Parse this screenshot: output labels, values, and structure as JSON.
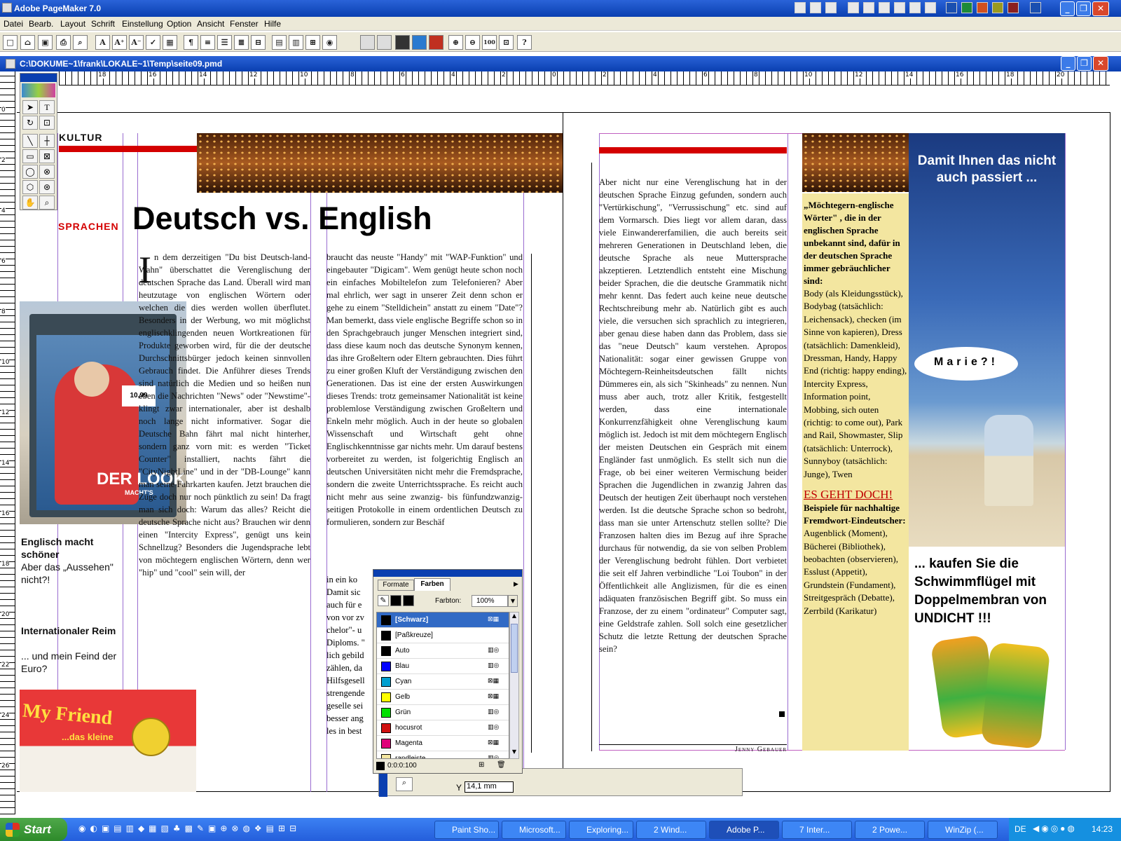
{
  "app": {
    "title": "Adobe PageMaker 7.0"
  },
  "menu": [
    "Datei",
    "Bearb.",
    "Layout",
    "Schrift",
    "Einstellung",
    "Option",
    "Ansicht",
    "Fenster",
    "Hilfe"
  ],
  "toolbar_glyphs": [
    "□",
    "⌂",
    "▣",
    "⎙",
    "⌕",
    "A",
    "A⁺",
    "A⁻",
    "✓",
    "▦",
    "¶",
    "≡",
    "☰",
    "≣",
    "⊟",
    "▤",
    "▥",
    "⊞",
    "◉",
    "⊕",
    "⊖",
    "100",
    "⊡",
    "?"
  ],
  "document": {
    "path": "C:\\DOKUME~1\\frank\\LOKALE~1\\Temp\\seite09.pmd"
  },
  "ruler_top_labels": [
    "18",
    "16",
    "14",
    "12",
    "10",
    "8",
    "6",
    "4",
    "2",
    "0",
    "2",
    "4",
    "6",
    "8",
    "10",
    "12",
    "14",
    "16",
    "18",
    "20"
  ],
  "ruler_left_labels": [
    "0",
    "2",
    "4",
    "6",
    "8",
    "10",
    "12",
    "14",
    "16",
    "18",
    "20",
    "22",
    "24",
    "26"
  ],
  "left_page": {
    "section": "KULTUR",
    "kicker": "SPRACHEN",
    "headline": "Deutsch vs. English",
    "caption1_title": "Englisch macht schöner",
    "caption1_text": "Aber das „Aussehen\" nicht?!",
    "caption2_title": "Internationaler Reim",
    "caption2_text": "... und mein Feind der Euro?",
    "poster_brand": "DER LOOK",
    "poster_sub": "MACHT'S",
    "poster_price": "10,99",
    "sign_text": "My Friend",
    "sign_sub": "...das kleine",
    "dropcap": "I",
    "col1": "n dem derzeitigen \"Du bist Deutsch-land-Wahn\" überschattet die Verenglischung der deutschen Sprache das Land. Überall wird man heutzutage von englischen Wörtern oder welchen die dies werden wollen überflutet. Besonders in der Werbung, wo mit möglichst englischklingenden neuen Wortkreationen für Produkte geworben wird, für die der deutsche Durchschnittsbürger jedoch keinen sinnvollen Gebrauch findet. Die Anführer dieses Trends sind natürlich die Medien und so heißen nun eben die Nachrichten \"News\" oder \"Newstime\"- klingt zwar internationaler, aber ist deshalb noch lange nicht informativer. Sogar die Deutsche Bahn fährt mal nicht hinterher, sondern ganz vorn mit: es werden \"Ticket Counter\" installiert, nachts fährt die \"CityNightLine\" und in der \"DB-Lounge\" kann man seine Fahrkarten kaufen. Jetzt brauchen die Züge doch nur noch pünktlich zu sein! Da fragt man sich doch: Warum das alles? Reicht die deutsche Sprache nicht aus? Brauchen wir denn einen \"Intercity Express\", genügt uns kein Schnellzug? Besonders die Jugendsprache lebt von möchtegern englischen Wörtern, denn wer \"hip\" und \"cool\" sein will, der",
    "col2": "braucht das neuste \"Handy\" mit \"WAP-Funktion\" und eingebauter \"Digicam\". Wem genügt heute schon noch ein einfaches Mobiltelefon zum Telefonieren? Aber mal ehrlich, wer sagt in unserer Zeit denn schon er gehe zu einem \"Stelldichein\" anstatt zu einem \"Date\"? Man bemerkt, dass viele englische Begriffe schon so in den Sprachgebrauch junger Menschen integriert sind, dass diese kaum noch das deutsche Synonym kennen, das ihre Großeltern oder Eltern gebrauchten. Dies führt zu einer großen Kluft der Verständigung zwischen den Generationen. Das ist eine der ersten Auswirkungen dieses Trends: trotz gemeinsamer Nationalität ist keine problemlose Verständigung zwischen Großeltern und Enkeln mehr möglich. Auch in der heute so globalen Wissenschaft und Wirtschaft geht ohne Englischkenntnisse gar nichts mehr. Um darauf bestens vorbereitet zu werden, ist folgerichtig Englisch an deutschen Universitäten nicht mehr die Fremdsprache, sondern die zweite Unterrichtssprache. Es reicht auch nicht mehr aus seine zwanzig- bis fünfundzwanzig-seitigen Protokolle in einem ordentlichen Deutsch zu formulieren, sondern zur Beschäf",
    "col2_tail": [
      "in ein ko",
      "Damit sic",
      "auch für e",
      "von vor zv",
      "chelor\"- u",
      "Diploms. \"",
      "lich gebild",
      "zählen, da",
      "Hilfsgesell",
      "strengende",
      "geselle sei",
      "besser ang",
      "les in best"
    ]
  },
  "right_page": {
    "col1": "Aber nicht nur eine Verenglischung hat in der deutschen Sprache Einzug gefunden, sondern auch \"Vertürkischung\", \"Verrussischung\" etc. sind auf dem Vormarsch. Dies liegt vor allem daran, dass viele Einwandererfamilien, die auch bereits seit mehreren Generationen in Deutschland leben, die deutsche Sprache als neue Muttersprache akzeptieren. Letztendlich entsteht eine Mischung beider Sprachen, die die deutsche Grammatik nicht mehr kennt. Das federt auch keine neue deutsche Rechtschreibung mehr ab. Natürlich gibt es auch viele, die versuchen sich sprachlich zu integrieren, aber genau diese haben dann das Problem, dass sie das \"neue Deutsch\" kaum verstehen. Apropos Nationalität: sogar einer gewissen Gruppe von Möchtegern-Reinheitsdeutschen fällt nichts Dümmeres ein, als sich \"Skinheads\" zu nennen. Nun muss aber auch, trotz aller Kritik, festgestellt werden, dass eine internationale Konkurrenzfähigkeit ohne Verenglischung kaum möglich ist. Jedoch ist mit dem möchtegern Englisch der meisten Deutschen ein Gespräch mit einem Engländer fast unmöglich. Es stellt sich nun die Frage, ob bei einer weiteren Vermischung beider Sprachen die Jugendlichen in zwanzig Jahren das Deutsch der heutigen Zeit überhaupt noch verstehen werden. Ist die deutsche Sprache schon so bedroht, dass man sie unter Artenschutz stellen sollte? Die Franzosen halten dies im Bezug auf ihre Sprache durchaus für notwendig, da sie von selben Problem der Verenglischung bedroht fühlen. Dort verbietet die seit elf Jahren verbindliche \"Loi Toubon\" in der Öffentlichkeit alle Anglizismen, für die es einen adäquaten französischen Begriff gibt. So muss ein Franzose, der zu einem \"ordinateur\" Computer sagt, eine Geldstrafe zahlen. Soll solch eine gesetzlicher Schutz die letzte Rettung der deutschen Sprache sein?",
    "author": "Jenny Gebauer",
    "box_title": "„Möchtegern-englische Wörter\" , die in der englischen Sprache unbekannt sind, dafür in der deutschen Sprache immer gebräuchlicher sind:",
    "box_text": "Body (als Kleidungsstück), Bodybag (tatsächlich: Leichensack), checken (im Sinne von kapieren), Dress (tatsächlich: Damenkleid), Dressman, Handy, Happy End (richtig: happy ending), Intercity Express, Information point, Mobbing, sich outen (richtig: to come out), Park and Rail, Showmaster, Slip (tatsächlich: Unterrock), Sunnyboy (tatsächlich: Junge), Twen",
    "box2_head": "ES GEHT DOCH!",
    "box2_title": "Beispiele für nachhaltige Fremdwort-Eindeutscher:",
    "box2_text": "Augenblick (Moment), Bücherei (Bibliothek), beobachten (observieren), Esslust (Appetit), Grundstein (Fundament), Streitgespräch (Debatte), Zerrbild (Karikatur)",
    "ad_top": "Damit Ihnen das nicht auch passiert ...",
    "bubble": "Marie?!",
    "ad_bottom": "... kaufen Sie die Schwimmflügel mit Doppelmembran von UNDICHT !!!"
  },
  "palette": {
    "tabs": [
      "Formate",
      "Farben"
    ],
    "tint_label": "Farbton:",
    "tint_value": "100%",
    "colors": [
      {
        "name": "[Schwarz]",
        "color": "#000000",
        "selected": true
      },
      {
        "name": "[Paßkreuze]",
        "color": "#000000"
      },
      {
        "name": "Auto",
        "color": "#000000"
      },
      {
        "name": "Blau",
        "color": "#0000ff"
      },
      {
        "name": "Cyan",
        "color": "#00a0d0"
      },
      {
        "name": "Gelb",
        "color": "#ffff00"
      },
      {
        "name": "Grün",
        "color": "#00e000"
      },
      {
        "name": "hocusrot",
        "color": "#d01010"
      },
      {
        "name": "Magenta",
        "color": "#e0007a"
      },
      {
        "name": "randleiste",
        "color": "#f3e6a0"
      }
    ],
    "footer": "0:0:0:100"
  },
  "control_palette": {
    "y_label": "Y",
    "y_value": "14,1 mm"
  },
  "taskbar": {
    "start": "Start",
    "tasks": [
      "Paint Sho...",
      "Microsoft...",
      "Exploring...",
      "2 Wind...",
      "Adobe P...",
      "7 Inter...",
      "2 Powe...",
      "WinZip (..."
    ],
    "lang": "DE",
    "clock": "14:23"
  },
  "colors": {
    "accent_red": "#d40000",
    "box_yellow": "#f3e6a0",
    "title_blue": "#0a3fb0"
  }
}
